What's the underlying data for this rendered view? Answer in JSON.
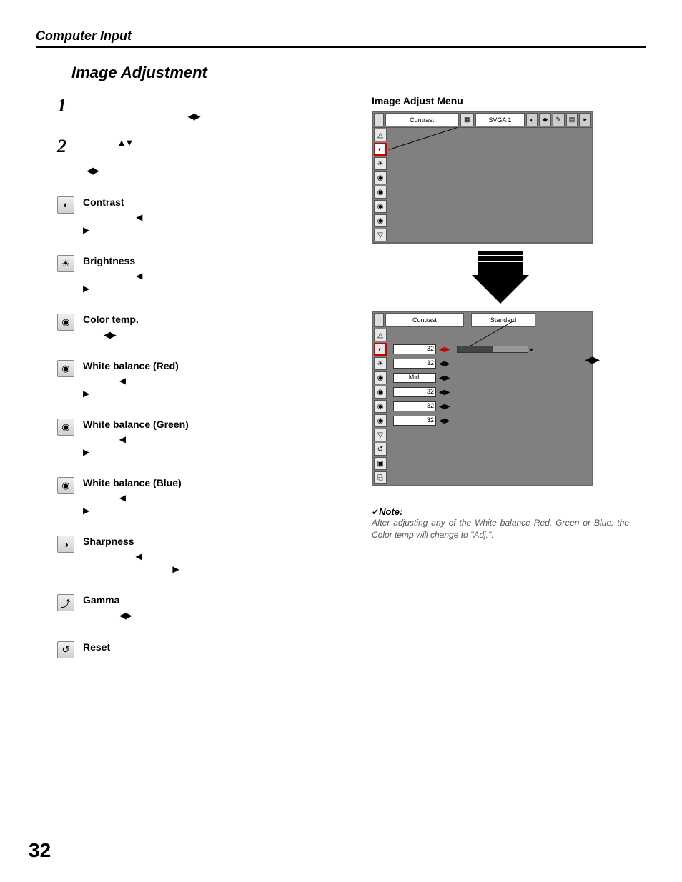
{
  "header": "Computer Input",
  "heading": "Image Adjustment",
  "steps": {
    "s1": {
      "num": "1"
    },
    "s2": {
      "num": "2"
    }
  },
  "items": [
    {
      "label": "Contrast"
    },
    {
      "label": "Brightness"
    },
    {
      "label": "Color temp."
    },
    {
      "label": "White balance (Red)"
    },
    {
      "label": "White balance (Green)"
    },
    {
      "label": "White balance (Blue)"
    },
    {
      "label": "Sharpness"
    },
    {
      "label": "Gamma"
    },
    {
      "label": "Reset"
    }
  ],
  "menu": {
    "title": "Image Adjust Menu",
    "header_label": "Contrast",
    "header_mode": "SVGA 1"
  },
  "menu2": {
    "header_label": "Contrast",
    "header_mode": "Standard",
    "rows": [
      {
        "val": "32"
      },
      {
        "val": "32"
      },
      {
        "val": "Mid"
      },
      {
        "val": "32"
      },
      {
        "val": "32"
      },
      {
        "val": "32"
      }
    ]
  },
  "note": {
    "head": "Note:",
    "body": "After adjusting any of the White balance Red, Green or Blue, the Color temp will change to \"Adj.\"."
  },
  "page_number": "32",
  "chart_data": {
    "type": "table",
    "title": "Image Adjust Menu values",
    "categories": [
      "Contrast",
      "Brightness",
      "Color temp.",
      "White balance (Red)",
      "White balance (Green)",
      "White balance (Blue)"
    ],
    "values": [
      "32",
      "32",
      "Mid",
      "32",
      "32",
      "32"
    ]
  }
}
